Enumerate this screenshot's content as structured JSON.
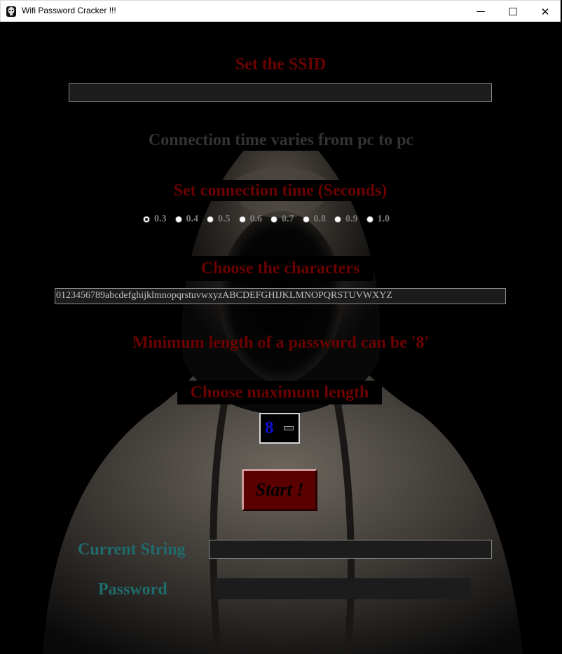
{
  "window": {
    "title": "Wifi Password Cracker !!!",
    "controls": {
      "minimize": "—",
      "maximize": "☐",
      "close": "✕"
    }
  },
  "ssid": {
    "label": "Set the SSID",
    "value": ""
  },
  "connection_note": "Connection time varies from pc to pc",
  "connection_time": {
    "label": "Set connection time (Seconds)",
    "options": [
      "0.3",
      "0.4",
      "0.5",
      "0.6",
      "0.7",
      "0.8",
      "0.9",
      "1.0"
    ],
    "selected": "0.3"
  },
  "characters": {
    "label": "Choose the characters",
    "value": "0123456789abcdefghijklmnopqrstuvwxyzABCDEFGHIJKLMNOPQRSTUVWXYZ"
  },
  "min_length_note": "Minimum length of a password can be '8'",
  "max_length": {
    "label": "Choose maximum length",
    "value": "8"
  },
  "start_button": "Start !",
  "current_string": {
    "label": "Current String",
    "value": ""
  },
  "password": {
    "label": "Password",
    "value": ""
  },
  "colors": {
    "label_red": "#6b0000",
    "note_gray": "#333333",
    "teal": "#1f6b6b",
    "button_red": "#5a0000",
    "spin_blue": "#1010d0"
  },
  "icons": {
    "app": "hooded-figure-icon",
    "minimize": "minimize-icon",
    "maximize": "maximize-icon",
    "close": "close-icon"
  }
}
